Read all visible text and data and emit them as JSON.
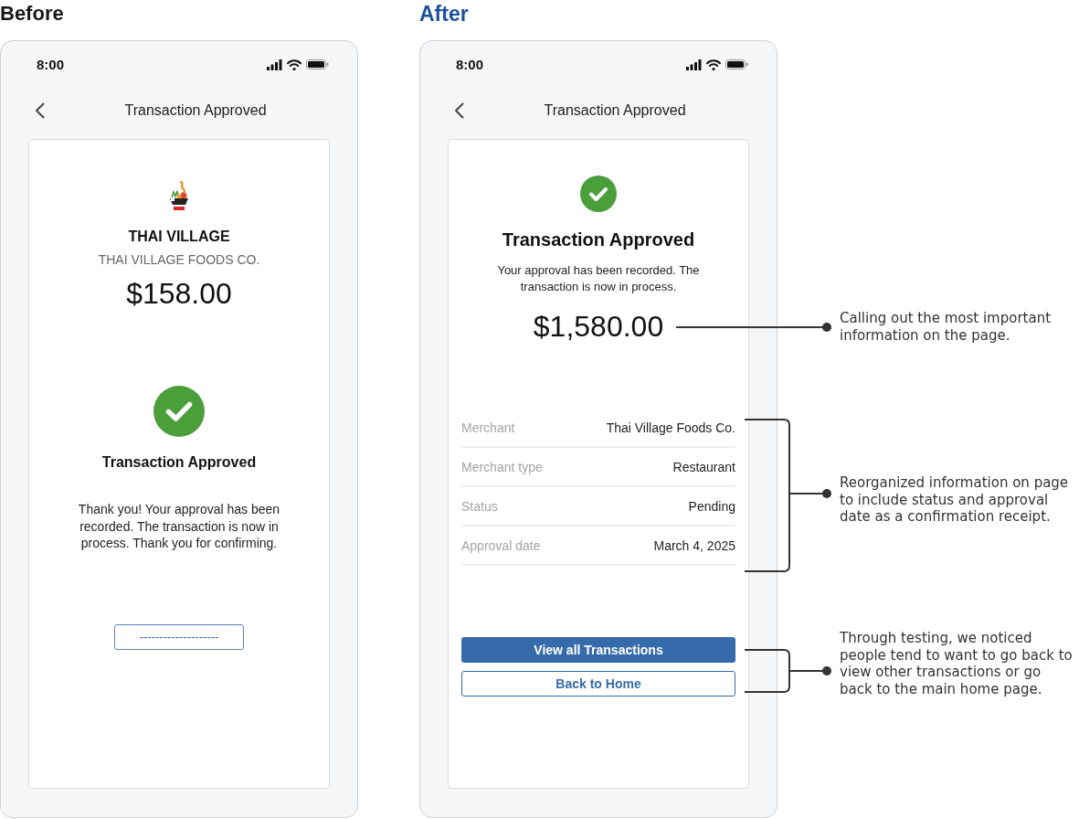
{
  "before": {
    "heading": "Before",
    "status_bar": {
      "time": "8:00"
    },
    "nav": {
      "title": "Transaction Approved"
    },
    "merchant": {
      "name": "THAI VILLAGE",
      "legal_name": "THAI VILLAGE FOODS CO."
    },
    "amount": "$158.00",
    "confirmation": {
      "title": "Transaction Approved",
      "message": "Thank you! Your approval has been recorded. The transaction is now in process. Thank you for confirming."
    },
    "button": {
      "label": "--------------------"
    }
  },
  "after": {
    "heading": "After",
    "status_bar": {
      "time": "8:00"
    },
    "nav": {
      "title": "Transaction Approved"
    },
    "confirmation": {
      "title": "Transaction Approved",
      "message": "Your approval has been recorded. The transaction is now in process."
    },
    "amount": "$1,580.00",
    "details": [
      {
        "label": "Merchant",
        "value": "Thai Village Foods Co."
      },
      {
        "label": "Merchant type",
        "value": "Restaurant"
      },
      {
        "label": "Status",
        "value": "Pending"
      },
      {
        "label": "Approval date",
        "value": "March 4, 2025"
      }
    ],
    "buttons": [
      {
        "label": "View all Transactions",
        "kind": "primary"
      },
      {
        "label": "Back to Home",
        "kind": "secondary"
      }
    ]
  },
  "annotations": [
    {
      "kind": "line",
      "text": "Calling out the most important information on the page."
    },
    {
      "kind": "bracket",
      "text": "Reorganized information on page to include status and approval date as a confirmation receipt."
    },
    {
      "kind": "bracket",
      "text": "Through testing, we noticed people tend to want to go back to view other transactions or go back to the main home page."
    }
  ]
}
